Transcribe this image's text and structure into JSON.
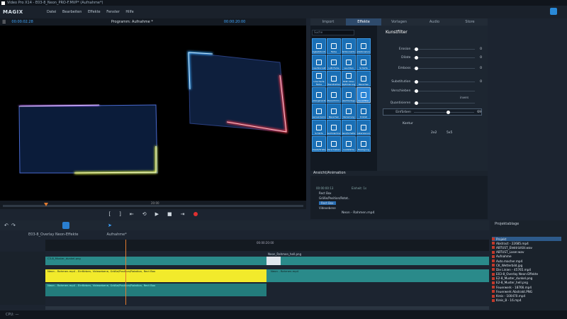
{
  "app": {
    "title": "Video Pro X14 - E03-8_Neon_PRO-F.MVP* (Aufnahme*)",
    "logo": "MAGIX",
    "menu": [
      "Datei",
      "Bearbeiten",
      "Effekte",
      "Fenster",
      "Hilfe"
    ]
  },
  "preview": {
    "timecode_left": "00:00:02.28",
    "title": "Programm: Aufnahme *",
    "timecode_right": "00:00:20:00",
    "marker": "20:00"
  },
  "right_tabs": [
    "Import",
    "Effekte",
    "Vorlagen",
    "Audio",
    "Store"
  ],
  "effects": {
    "search_placeholder": "Suche",
    "tiles": [
      "Helligkeit/Kontrast",
      "Farbe",
      "Farbkorrektur",
      "Gradationskurven",
      "Tonwertkorrektur",
      "LAB-Farbe",
      "Leuchten",
      "Schärfe",
      "Unscharfe Farbe",
      "Überstrahlen",
      "HDR Video Optimierung",
      "Rauschen",
      "Mustergenerator",
      "Rauschmin.",
      "Tonwertzerlegung",
      "Kunstfilter",
      "Linsenverzerrung",
      "Rauschen",
      "Verzerrung",
      "Kristall",
      "Schärfe",
      "Weichzeichner",
      "Glanz/Schatten",
      "Posterisierung",
      "Mosaik/Kristall",
      "Verschieben",
      "Lautstärke",
      "Bewegung"
    ]
  },
  "kunstfilter": {
    "title": "Kunstfilter",
    "sliders": [
      {
        "label": "Erosion",
        "value": "0"
      },
      {
        "label": "Dilate",
        "value": "0"
      },
      {
        "label": "Emboss",
        "value": "0"
      },
      {
        "label": "Substitution",
        "value": "0"
      },
      {
        "label": "Verschieben",
        "value": ""
      },
      {
        "label": "Quantisieren",
        "value": ""
      },
      {
        "label": "Einfärben",
        "value": "69"
      }
    ],
    "kontur": "Kontur",
    "k1": "2x2",
    "k2": "5x5",
    "invers": "invers"
  },
  "animation": {
    "title": "Ansicht/Animation",
    "rows": [
      "Rect Box",
      "Größe/Position/Rotat..",
      "Rect Box",
      "Videoebene",
      "Neon - Rahmen.mp4"
    ],
    "timecode": "00:00:00:13",
    "einheit": "Einheit: 1s"
  },
  "timeline": {
    "tabs": [
      "E03-8_Overlay Neon-Effekte",
      "Aufnahme*"
    ],
    "ruler": "00:00:20:00",
    "clips": {
      "top": "C3-8_Muster_dunkel.png",
      "top2": "Neon_Rahmen_hell.png",
      "yellow": "Neon - Rahmen.mp4 - Einfärben, Videoebene, Größe/Position/Rotation, Rect Box",
      "yellow2": "Neon - Rahmen.mp4",
      "bottom": "Neon - Rahmen.mp4 - Einfärben, Videoebene, Größe/Position/Rotation, Rect Box"
    }
  },
  "pool": {
    "title": "Projektablage",
    "items": [
      "Projekt",
      "Abstract - 22685.mp4",
      "ABTUST_Elektrizität.wav",
      "ABTUST_Laser.wav",
      "Aufnahme",
      "Auto.macher.mp4",
      "CK_Wetterbild.jpg",
      "Die Linien - 45765.mp4",
      "E03-8_Overlay Neon-Effekte",
      "E2-8_Muster_dunkel.png",
      "E2-8_Muster_hell.png",
      "Feuerwerk - 18766.mp4",
      "Feuerwerk Abstrakt.PNG",
      "Kreis - 100470.mp4",
      "Kreis_B - 16.mp4"
    ]
  },
  "status": "CPU: —"
}
